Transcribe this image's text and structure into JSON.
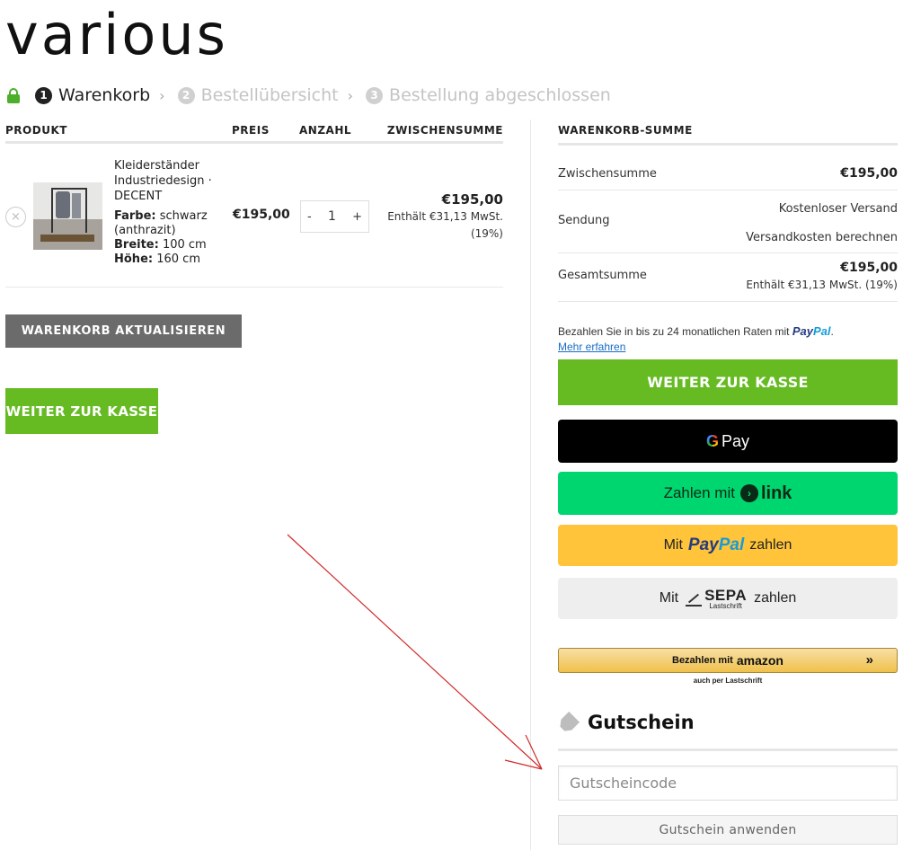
{
  "brand": {
    "logo": "various"
  },
  "steps": [
    {
      "num": "1",
      "label": "Warenkorb"
    },
    {
      "num": "2",
      "label": "Bestellübersicht"
    },
    {
      "num": "3",
      "label": "Bestellung abgeschlossen"
    }
  ],
  "step_separator": "›",
  "cart": {
    "headers": {
      "product": "PRODUKT",
      "price": "PREIS",
      "qty": "ANZAHL",
      "subtotal": "ZWISCHENSUMME"
    },
    "item": {
      "remove": "×",
      "name": "Kleiderständer Industriedesign · DECENT",
      "attributes": [
        {
          "key": "Farbe:",
          "value": "schwarz (anthrazit)"
        },
        {
          "key": "Breite:",
          "value": "100 cm"
        },
        {
          "key": "Höhe:",
          "value": "160 cm"
        }
      ],
      "price": "€195,00",
      "qty_minus": "-",
      "qty": "1",
      "qty_plus": "+",
      "subtotal": "€195,00",
      "tax_line1": "Enthält €31,13 MwSt.",
      "tax_line2": "(19%)"
    },
    "update_button": "WARENKORB AKTUALISIEREN",
    "checkout_button": "WEITER ZUR KASSE"
  },
  "totals": {
    "heading": "WARENKORB-SUMME",
    "subtotal_label": "Zwischensumme",
    "subtotal_value": "€195,00",
    "shipping_label": "Sendung",
    "shipping_free": "Kostenloser Versand",
    "shipping_calc": "Versandkosten berechnen",
    "total_label": "Gesamtsumme",
    "total_value": "€195,00",
    "total_tax": "Enthält €31,13 MwSt. (19%)"
  },
  "paypal_note": {
    "text": "Bezahlen Sie in bis zu 24 monatlichen Raten mit",
    "brand_a": "Pay",
    "brand_b": "Pal",
    "dot": ".",
    "link": "Mehr erfahren"
  },
  "payments": {
    "checkout": "WEITER ZUR KASSE",
    "gpay_g": "G",
    "gpay_text": "Pay",
    "link_prefix": "Zahlen mit",
    "link_dot": "›",
    "link_word": "link",
    "paypal_prefix": "Mit",
    "paypal_a": "Pay",
    "paypal_b": "Pal",
    "paypal_suffix": "zahlen",
    "sepa_prefix": "Mit",
    "sepa_big": "SEPA",
    "sepa_small": "Lastschrift",
    "sepa_suffix": "zahlen",
    "amazon_prefix": "Bezahlen mit",
    "amazon_brand": "amazon",
    "amazon_arrows": "»",
    "amazon_sub": "auch per Lastschrift"
  },
  "coupon": {
    "title": "Gutschein",
    "placeholder": "Gutscheincode",
    "apply": "Gutschein anwenden"
  },
  "colors": {
    "accent_green": "#66bb23",
    "link_green": "#00d66f",
    "paypal_yellow": "#ffc439",
    "annotation_arrow": "#d22a2a"
  }
}
